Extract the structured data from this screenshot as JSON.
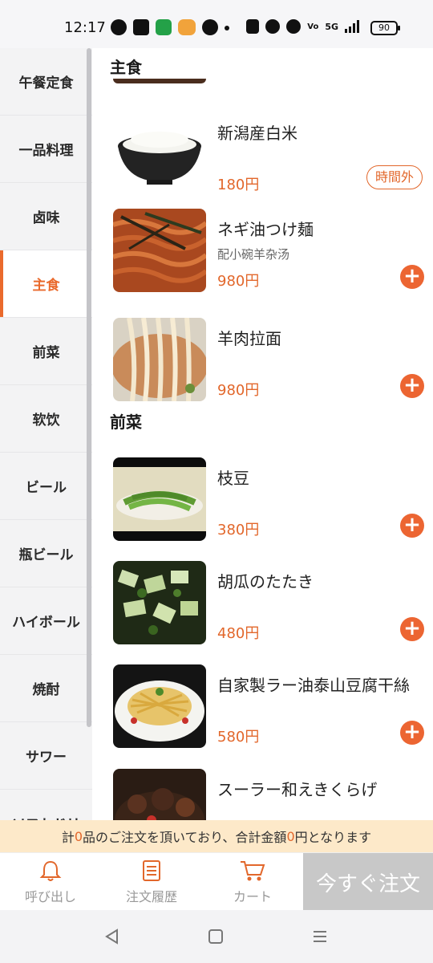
{
  "status_bar": {
    "time": "12:17",
    "battery": "90",
    "network": "5G"
  },
  "sidebar": {
    "items": [
      {
        "label": "午餐定食"
      },
      {
        "label": "一品料理"
      },
      {
        "label": "卤味"
      },
      {
        "label": "主食"
      },
      {
        "label": "前菜"
      },
      {
        "label": "软饮"
      },
      {
        "label": "ビール"
      },
      {
        "label": "瓶ビール"
      },
      {
        "label": "ハイボール"
      },
      {
        "label": "焼酎"
      },
      {
        "label": "サワー"
      },
      {
        "label": "ソフトドリ"
      }
    ],
    "active_index": 3
  },
  "sections": [
    {
      "title": "主食",
      "items": [
        {
          "name": "新潟産白米",
          "desc": "",
          "price": "180円",
          "status": "時間外"
        },
        {
          "name": "ネギ油つけ麺",
          "desc": "配小碗羊杂汤",
          "price": "980円",
          "status": ""
        },
        {
          "name": "羊肉拉面",
          "desc": "",
          "price": "980円",
          "status": ""
        }
      ]
    },
    {
      "title": "前菜",
      "items": [
        {
          "name": "枝豆",
          "desc": "",
          "price": "380円",
          "status": ""
        },
        {
          "name": "胡瓜のたたき",
          "desc": "",
          "price": "480円",
          "status": ""
        },
        {
          "name": "自家製ラー油泰山豆腐干絲",
          "desc": "",
          "price": "580円",
          "status": ""
        },
        {
          "name": "スーラー和えきくらげ",
          "desc": "",
          "price": "",
          "status": ""
        }
      ]
    }
  ],
  "summary": {
    "part1": "計",
    "count": "0",
    "part2": "品のご注文を頂いており、合計金額",
    "amount": "0",
    "part3": "円となります"
  },
  "bottom_nav": {
    "call": "呼び出し",
    "history": "注文履歴",
    "cart": "カート",
    "order_now": "今すぐ注文"
  },
  "colors": {
    "accent": "#ea6a2c",
    "summary_bg": "#fde9c9",
    "order_button_bg": "#c8c8c8"
  }
}
